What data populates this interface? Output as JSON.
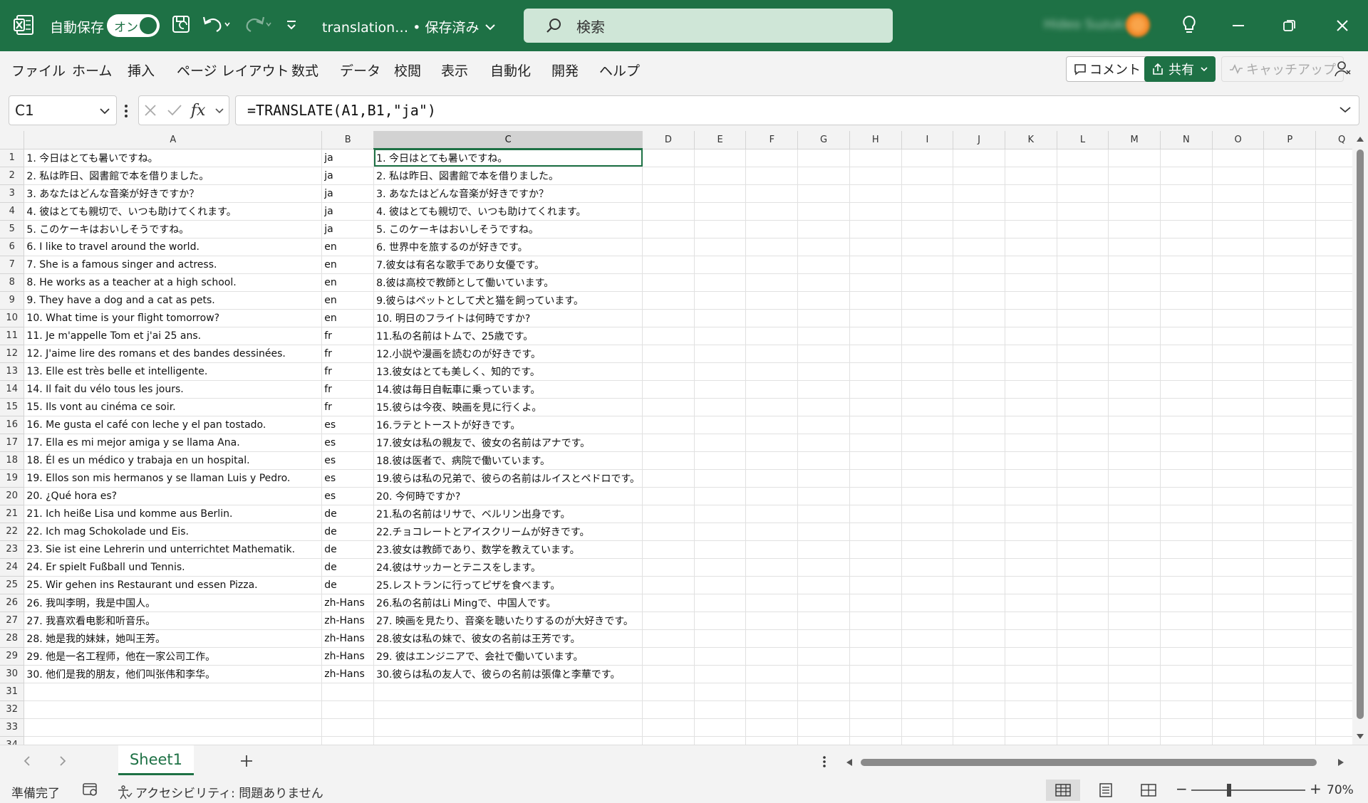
{
  "titlebar": {
    "autosave_label": "自動保存",
    "autosave_state": "オン",
    "filename": "translation… • 保存済み",
    "search_placeholder": "検索"
  },
  "menu": {
    "items": [
      "ファイル",
      "ホーム",
      "挿入",
      "ページ レイアウト",
      "数式",
      "データ",
      "校閲",
      "表示",
      "自動化",
      "開発",
      "ヘルプ"
    ],
    "comment": "コメント",
    "share": "共有",
    "catchup": "キャッチアップ"
  },
  "formula": {
    "namebox": "C1",
    "fx": "fx",
    "value": "=TRANSLATE(A1,B1,\"ja\")"
  },
  "columns": [
    "A",
    "B",
    "C",
    "D",
    "E",
    "F",
    "G",
    "H",
    "I",
    "J",
    "K",
    "L",
    "M",
    "N",
    "O",
    "P",
    "Q"
  ],
  "rows": [
    {
      "a": "1. 今日はとても暑いですね。",
      "b": "ja",
      "c": "1. 今日はとても暑いですね。"
    },
    {
      "a": "2. 私は昨日、図書館で本を借りました。",
      "b": "ja",
      "c": "2. 私は昨日、図書館で本を借りました。"
    },
    {
      "a": "3. あなたはどんな音楽が好きですか？",
      "b": "ja",
      "c": "3. あなたはどんな音楽が好きですか？"
    },
    {
      "a": "4. 彼はとても親切で、いつも助けてくれます。",
      "b": "ja",
      "c": "4. 彼はとても親切で、いつも助けてくれます。"
    },
    {
      "a": "5. このケーキはおいしそうですね。",
      "b": "ja",
      "c": "5. このケーキはおいしそうですね。"
    },
    {
      "a": "6. I like to travel around the world.",
      "b": "en",
      "c": "6. 世界中を旅するのが好きです。"
    },
    {
      "a": "7. She is a famous singer and actress.",
      "b": "en",
      "c": "7.彼女は有名な歌手であり女優です。"
    },
    {
      "a": "8. He works as a teacher at a high school.",
      "b": "en",
      "c": "8.彼は高校で教師として働いています。"
    },
    {
      "a": "9. They have a dog and a cat as pets.",
      "b": "en",
      "c": "9.彼らはペットとして犬と猫を飼っています。"
    },
    {
      "a": "10. What time is your flight tomorrow?",
      "b": "en",
      "c": "10. 明日のフライトは何時ですか?"
    },
    {
      "a": "11. Je m'appelle Tom et j'ai 25 ans.",
      "b": "fr",
      "c": "11.私の名前はトムで、25歳です。"
    },
    {
      "a": "12. J'aime lire des romans et des bandes dessinées.",
      "b": "fr",
      "c": "12.小説や漫画を読むのが好きです。"
    },
    {
      "a": "13. Elle est très belle et intelligente.",
      "b": "fr",
      "c": "13.彼女はとても美しく、知的です。"
    },
    {
      "a": "14. Il fait du vélo tous les jours.",
      "b": "fr",
      "c": "14.彼は毎日自転車に乗っています。"
    },
    {
      "a": "15. Ils vont au cinéma ce soir.",
      "b": "fr",
      "c": "15.彼らは今夜、映画を見に行くよ。"
    },
    {
      "a": "16. Me gusta el café con leche y el pan tostado.",
      "b": "es",
      "c": "16.ラテとトーストが好きです。"
    },
    {
      "a": "17. Ella es mi mejor amiga y se llama Ana.",
      "b": "es",
      "c": "17.彼女は私の親友で、彼女の名前はアナです。"
    },
    {
      "a": "18. Él es un médico y trabaja en un hospital.",
      "b": "es",
      "c": "18.彼は医者で、病院で働いています。"
    },
    {
      "a": "19. Ellos son mis hermanos y se llaman Luis y Pedro.",
      "b": "es",
      "c": "19.彼らは私の兄弟で、彼らの名前はルイスとペドロです。"
    },
    {
      "a": "20. ¿Qué hora es?",
      "b": "es",
      "c": "20. 今何時ですか?"
    },
    {
      "a": "21. Ich heiße Lisa und komme aus Berlin.",
      "b": "de",
      "c": "21.私の名前はリサで、ベルリン出身です。"
    },
    {
      "a": "22. Ich mag Schokolade und Eis.",
      "b": "de",
      "c": "22.チョコレートとアイスクリームが好きです。"
    },
    {
      "a": "23. Sie ist eine Lehrerin und unterrichtet Mathematik.",
      "b": "de",
      "c": "23.彼女は教師であり、数学を教えています。"
    },
    {
      "a": "24. Er spielt Fußball und Tennis.",
      "b": "de",
      "c": "24.彼はサッカーとテニスをします。"
    },
    {
      "a": "25. Wir gehen ins Restaurant und essen Pizza.",
      "b": "de",
      "c": "25.レストランに行ってピザを食べます。"
    },
    {
      "a": "26. 我叫李明，我是中国人。",
      "b": "zh-Hans",
      "c": "26.私の名前はLi Mingで、中国人です。"
    },
    {
      "a": "27. 我喜欢看电影和听音乐。",
      "b": "zh-Hans",
      "c": "27. 映画を見たり、音楽を聴いたりするのが大好きです。"
    },
    {
      "a": "28. 她是我的妹妹，她叫王芳。",
      "b": "zh-Hans",
      "c": "28.彼女は私の妹で、彼女の名前は王芳です。"
    },
    {
      "a": "29. 他是一名工程师，他在一家公司工作。",
      "b": "zh-Hans",
      "c": "29. 彼はエンジニアで、会社で働いています。"
    },
    {
      "a": "30. 他们是我的朋友，他们叫张伟和李华。",
      "b": "zh-Hans",
      "c": "30.彼らは私の友人で、彼らの名前は張偉と李華です。"
    },
    {
      "a": "",
      "b": "",
      "c": ""
    },
    {
      "a": "",
      "b": "",
      "c": ""
    },
    {
      "a": "",
      "b": "",
      "c": ""
    },
    {
      "a": "",
      "b": "",
      "c": ""
    }
  ],
  "sheet_tab": "Sheet1",
  "status": {
    "ready": "準備完了",
    "accessibility": "アクセシビリティ: 問題ありません",
    "zoom": "70%"
  },
  "colors": {
    "accent": "#1e7145"
  }
}
